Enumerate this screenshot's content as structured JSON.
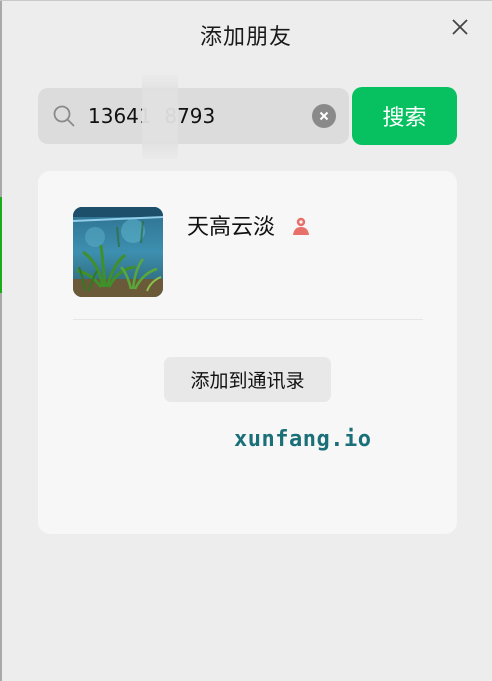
{
  "dialog": {
    "title": "添加朋友"
  },
  "search": {
    "value": "13641  8793",
    "button_label": "搜索"
  },
  "result": {
    "name": "天高云淡",
    "gender": "female",
    "add_button_label": "添加到通讯录"
  },
  "watermark": "xunfang.io",
  "colors": {
    "accent_green": "#07c160",
    "gender_female": "#e8706a",
    "watermark": "#1a6f78"
  },
  "icons": {
    "close": "close-icon",
    "search": "search-icon",
    "clear": "clear-icon",
    "gender": "female-gender-icon"
  }
}
